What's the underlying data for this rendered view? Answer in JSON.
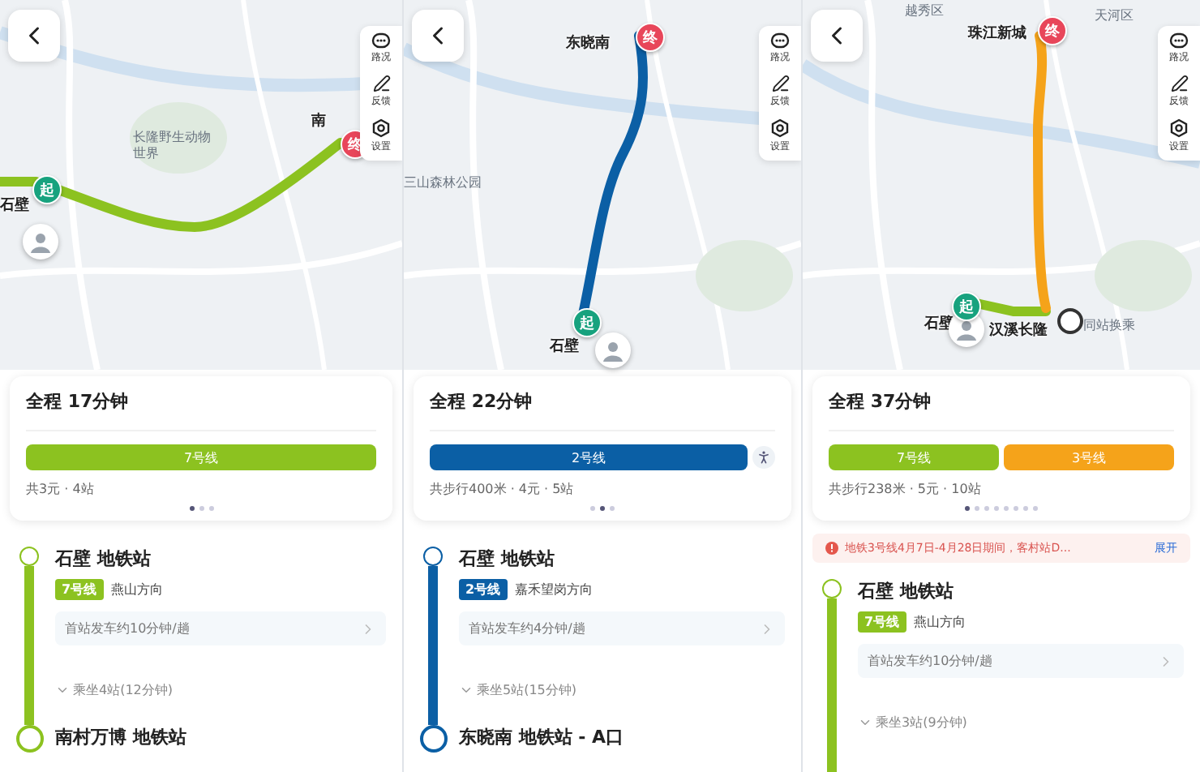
{
  "panels": [
    {
      "map": {
        "start_marker": "起",
        "end_marker": "终",
        "stations": [
          {
            "text": "石壁"
          },
          {
            "text": "南"
          }
        ],
        "places": [
          {
            "text": "长隆野生动物世界"
          }
        ],
        "transfer": false
      },
      "tools": [
        {
          "label": "路况",
          "kind": "traffic"
        },
        {
          "label": "反馈",
          "kind": "feedback"
        },
        {
          "label": "设置",
          "kind": "settings"
        }
      ],
      "summary": {
        "title": "全程 17分钟",
        "segments": [
          {
            "label": "7号线",
            "color": "#8cc220"
          }
        ],
        "walk": false,
        "info": "共3元 · 4站",
        "pages": [
          {
            "selected": true
          },
          {
            "selected": false
          },
          {
            "selected": false
          }
        ]
      },
      "details": {
        "start_station": "石壁 地铁站",
        "line": {
          "label": "7号线",
          "color": "#8cc220"
        },
        "direction": "燕山方向",
        "frequency": "首站发车约10分钟/趟",
        "ride": "乘坐4站(12分钟)",
        "end_station": "南村万博 地铁站"
      }
    },
    {
      "map": {
        "start_marker": "起",
        "end_marker": "终",
        "stations": [
          {
            "text": "石壁"
          },
          {
            "text": "东晓南"
          }
        ],
        "places": [
          {
            "text": "三山森林公园"
          }
        ],
        "transfer": false
      },
      "tools": [
        {
          "label": "路况",
          "kind": "traffic"
        },
        {
          "label": "反馈",
          "kind": "feedback"
        },
        {
          "label": "设置",
          "kind": "settings"
        }
      ],
      "summary": {
        "title": "全程 22分钟",
        "segments": [
          {
            "label": "2号线",
            "color": "#0b5fa5"
          }
        ],
        "walk": true,
        "info": "共步行400米 · 4元 · 5站",
        "pages": [
          {
            "selected": false
          },
          {
            "selected": true
          },
          {
            "selected": false
          }
        ]
      },
      "details": {
        "start_station": "石壁 地铁站",
        "line": {
          "label": "2号线",
          "color": "#0b5fa5"
        },
        "direction": "嘉禾望岗方向",
        "frequency": "首站发车约4分钟/趟",
        "ride": "乘坐5站(15分钟)",
        "end_station": "东晓南 地铁站 - A口"
      }
    },
    {
      "map": {
        "start_marker": "起",
        "end_marker": "终",
        "stations": [
          {
            "text": "石壁"
          },
          {
            "text": "汉溪长隆"
          },
          {
            "text": "珠江新城"
          }
        ],
        "places": [
          {
            "text": "越秀区"
          },
          {
            "text": "天河区"
          },
          {
            "text": "同站换乘"
          }
        ],
        "transfer": true
      },
      "tools": [
        {
          "label": "路况",
          "kind": "traffic"
        },
        {
          "label": "反馈",
          "kind": "feedback"
        },
        {
          "label": "设置",
          "kind": "settings"
        }
      ],
      "summary": {
        "title": "全程 37分钟",
        "segments": [
          {
            "label": "7号线",
            "color": "#8cc220"
          },
          {
            "label": "3号线",
            "color": "#f5a31a"
          }
        ],
        "walk": false,
        "info": "共步行238米 · 5元 · 10站",
        "pages": [
          {
            "selected": true
          },
          {
            "selected": false
          },
          {
            "selected": false
          },
          {
            "selected": false
          },
          {
            "selected": false
          },
          {
            "selected": false
          },
          {
            "selected": false
          },
          {
            "selected": false
          }
        ]
      },
      "notice": {
        "text": "地铁3号线4月7日-4月28日期间，客村站D...",
        "action": "展开"
      },
      "details": {
        "start_station": "石壁 地铁站",
        "line": {
          "label": "7号线",
          "color": "#8cc220"
        },
        "direction": "燕山方向",
        "frequency": "首站发车约10分钟/趟",
        "ride": "乘坐3站(9分钟)"
      }
    }
  ]
}
